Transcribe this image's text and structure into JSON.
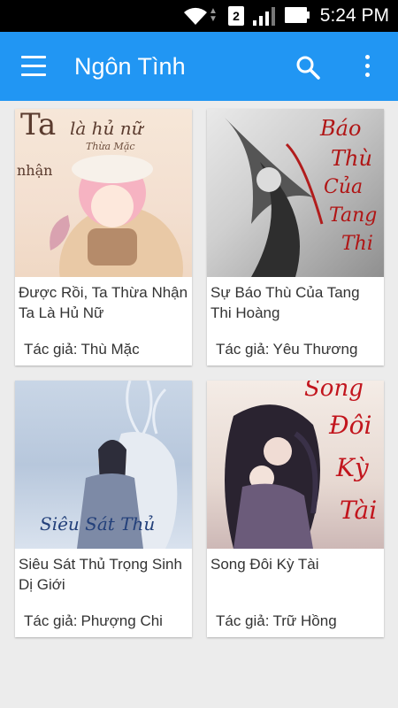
{
  "status_bar": {
    "sim_slot": "2",
    "time": "5:24 PM"
  },
  "app_bar": {
    "title": "Ngôn Tình"
  },
  "author_prefix": "Tác giả:",
  "books": [
    {
      "title": "Được Rồi, Ta Thừa Nhận Ta Là Hủ Nữ",
      "author": "Thù Mặc",
      "cover_lines": [
        "Ta",
        "là hủ nữ",
        "Thừa Mặc",
        "nhận"
      ]
    },
    {
      "title": "Sự Báo Thù Của Tang Thi Hoàng",
      "author": "Yêu Thương",
      "cover_lines": [
        "Báo",
        "Thù",
        "Của",
        "Tang",
        "Thi"
      ]
    },
    {
      "title": "Siêu Sát Thủ Trọng Sinh Dị Giới",
      "author": "Phượng Chi",
      "cover_lines": [
        "Siêu Sát Thủ"
      ]
    },
    {
      "title": "Song Đôi Kỳ Tài",
      "author": "Trữ Hồng",
      "cover_lines": [
        "Song",
        "Đôi",
        "Kỳ",
        "Tài"
      ]
    }
  ],
  "colors": {
    "app_bar": "#2196f3",
    "status_bar": "#000000",
    "background": "#ececec"
  }
}
